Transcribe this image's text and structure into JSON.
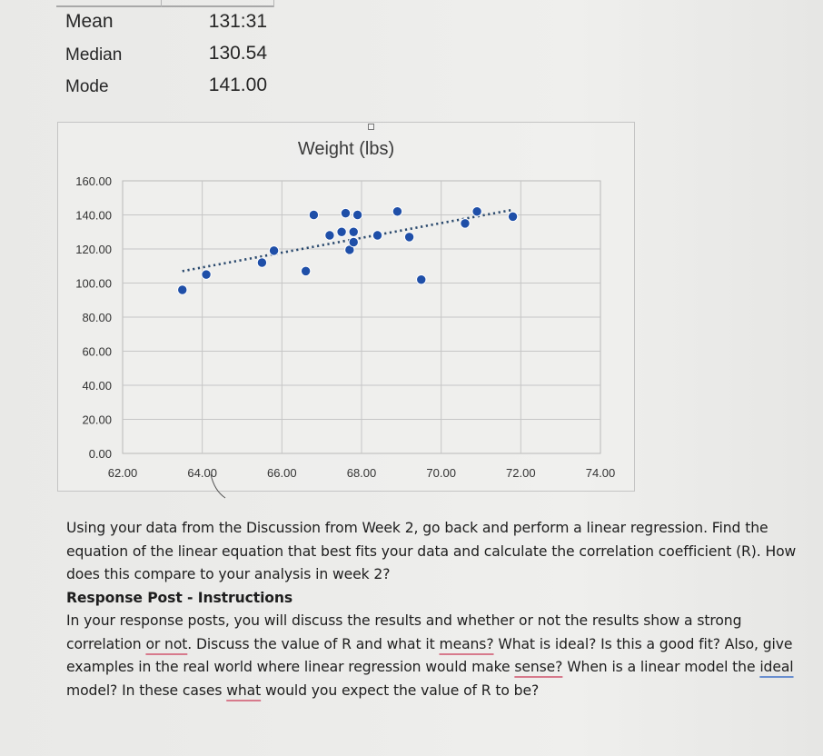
{
  "summary_stats": [
    {
      "label": "Mean",
      "value": "131:31"
    },
    {
      "label": "Median",
      "value": "130.54"
    },
    {
      "label": "Mode",
      "value": "141.00"
    }
  ],
  "chart_data": {
    "type": "scatter",
    "title": "Weight (lbs)",
    "xlabel": "",
    "ylabel": "",
    "xlim": [
      62,
      74
    ],
    "ylim": [
      0,
      160
    ],
    "x_ticks": [
      "62.00",
      "64.00",
      "66.00",
      "68.00",
      "70.00",
      "72.00",
      "74.00"
    ],
    "y_ticks": [
      "0.00",
      "20.00",
      "40.00",
      "60.00",
      "80.00",
      "100.00",
      "120.00",
      "140.00",
      "160.00"
    ],
    "x_tick_values": [
      62,
      64,
      66,
      68,
      70,
      72,
      74
    ],
    "y_tick_values": [
      0,
      20,
      40,
      60,
      80,
      100,
      120,
      140,
      160
    ],
    "grid": true,
    "legend": "none",
    "series": [
      {
        "name": "Weight (lbs)",
        "color": "#1f4fa8",
        "points": [
          {
            "x": 63.5,
            "y": 96
          },
          {
            "x": 64.1,
            "y": 105
          },
          {
            "x": 65.5,
            "y": 112
          },
          {
            "x": 65.8,
            "y": 119
          },
          {
            "x": 66.6,
            "y": 107
          },
          {
            "x": 66.8,
            "y": 140
          },
          {
            "x": 67.2,
            "y": 128
          },
          {
            "x": 67.5,
            "y": 130
          },
          {
            "x": 67.6,
            "y": 141
          },
          {
            "x": 67.7,
            "y": 119.5
          },
          {
            "x": 67.8,
            "y": 130
          },
          {
            "x": 67.8,
            "y": 124
          },
          {
            "x": 67.9,
            "y": 140
          },
          {
            "x": 68.4,
            "y": 128
          },
          {
            "x": 68.9,
            "y": 142
          },
          {
            "x": 69.2,
            "y": 127
          },
          {
            "x": 69.5,
            "y": 102
          },
          {
            "x": 70.6,
            "y": 135
          },
          {
            "x": 70.9,
            "y": 142
          },
          {
            "x": 71.8,
            "y": 139
          }
        ]
      }
    ],
    "trendline": {
      "type": "linear",
      "style": "dotted",
      "color": "#2b4a6e",
      "from": {
        "x": 63.5,
        "y": 107
      },
      "to": {
        "x": 71.8,
        "y": 143
      }
    }
  },
  "instructions": {
    "intro": "Using your data from the Discussion from Week 2, go back and perform a linear regression.  Find the equation of the linear equation that best fits your data and calculate the correlation coefficient (R).  How does this compare to your analysis in week 2?",
    "response_heading": "Response Post - Instructions",
    "response_parts": [
      {
        "text": "In your response posts, you will discuss the results and whether or not the results show a strong correlation ",
        "mark": ""
      },
      {
        "text": "or not",
        "mark": "red"
      },
      {
        "text": ".  Discuss the value of R and what it ",
        "mark": ""
      },
      {
        "text": "means?",
        "mark": "red"
      },
      {
        "text": "  What is ideal?  Is this a good fit?  Also, give examples in the real world where linear regression would make ",
        "mark": ""
      },
      {
        "text": "sense?",
        "mark": "red"
      },
      {
        "text": "  When is a linear model the ",
        "mark": ""
      },
      {
        "text": "ideal",
        "mark": "blue"
      },
      {
        "text": " model?  In these cases ",
        "mark": ""
      },
      {
        "text": "what",
        "mark": "red"
      },
      {
        "text": " would you expect the value of R to be?",
        "mark": ""
      }
    ]
  }
}
